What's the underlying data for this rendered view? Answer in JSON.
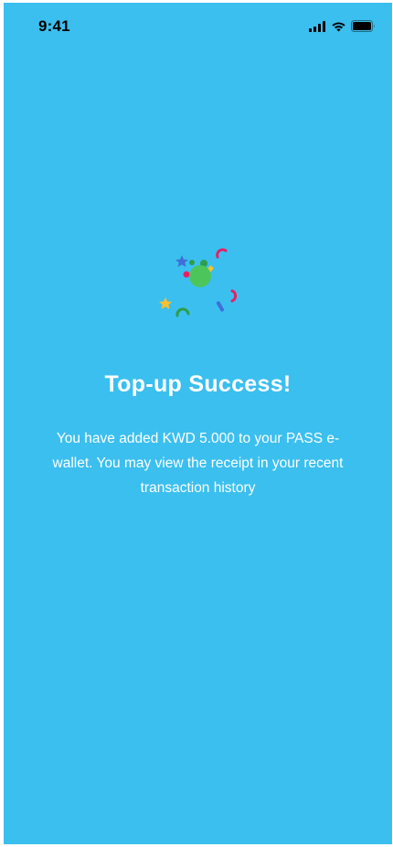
{
  "status_bar": {
    "time": "9:41",
    "icons": [
      "cellular-signal-icon",
      "wifi-icon",
      "battery-icon"
    ]
  },
  "illustration": {
    "name": "celebration-confetti-icon",
    "colors": [
      "#4caf50",
      "#e91e63",
      "#fbc02d",
      "#3f6fd8",
      "#2e7d32"
    ]
  },
  "success": {
    "title": "Top-up Success!",
    "message": "You have added KWD 5.000 to your PASS e-wallet. You may view the receipt in your recent transaction history"
  },
  "colors": {
    "background": "#3bbfef",
    "text": "#ffffff"
  }
}
